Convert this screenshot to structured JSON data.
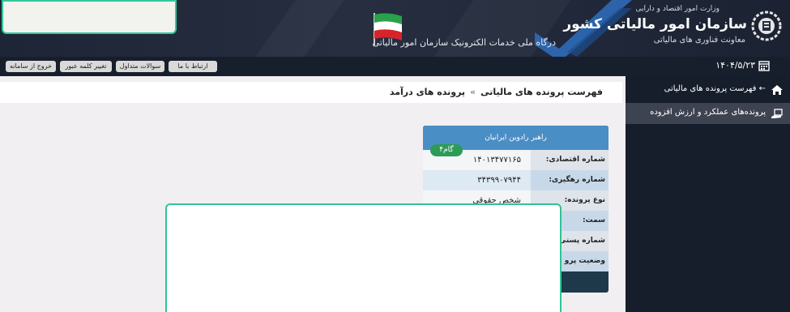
{
  "header": {
    "ministry": "وزارت امور اقتصاد و دارایی",
    "org_name": "سازمان امور مالیاتی کشور",
    "deputy": "معاونت فناوری های مالیاتی",
    "portal_title": "درگاه ملی خدمات الکترونیک سازمان امور مالیاتی"
  },
  "toolbar": {
    "date": "۱۴۰۴/۵/۲۳",
    "contact": "ارتباط با ما",
    "faq": "سوالات متداول",
    "change_password": "تغییر کلمه عبور",
    "logout": "خروج از سامانه"
  },
  "sidebar": {
    "items": [
      {
        "label": "← فهرست پرونده های مالیاتی"
      },
      {
        "label": "پرونده‌های عملکرد و ارزش افزوده"
      }
    ]
  },
  "breadcrumb": {
    "parent": "فهرست پرونده های مالیاتی",
    "separator": "»",
    "current": "پرونده های درآمد"
  },
  "card": {
    "name": "راهبر رادوین ایرانیان",
    "stage": "گام۴",
    "rows": [
      {
        "key": "شماره اقتصادی:",
        "value": "۱۴۰۱۳۴۷۷۱۶۵"
      },
      {
        "key": "شماره رهگیری:",
        "value": "۳۴۳۹۹۰۷۹۴۴"
      },
      {
        "key": "نوع پرونده:",
        "value": "شخص حقوقی"
      },
      {
        "key": "سمت:",
        "value": ""
      },
      {
        "key": "شماره پستی",
        "value": ""
      },
      {
        "key": "وضعیت پرو",
        "value": ""
      }
    ]
  },
  "colors": {
    "header_bg": "#1e2536",
    "accent_green": "#2fc493",
    "card_header": "#4a8ec6",
    "badge": "#2d9b58"
  }
}
